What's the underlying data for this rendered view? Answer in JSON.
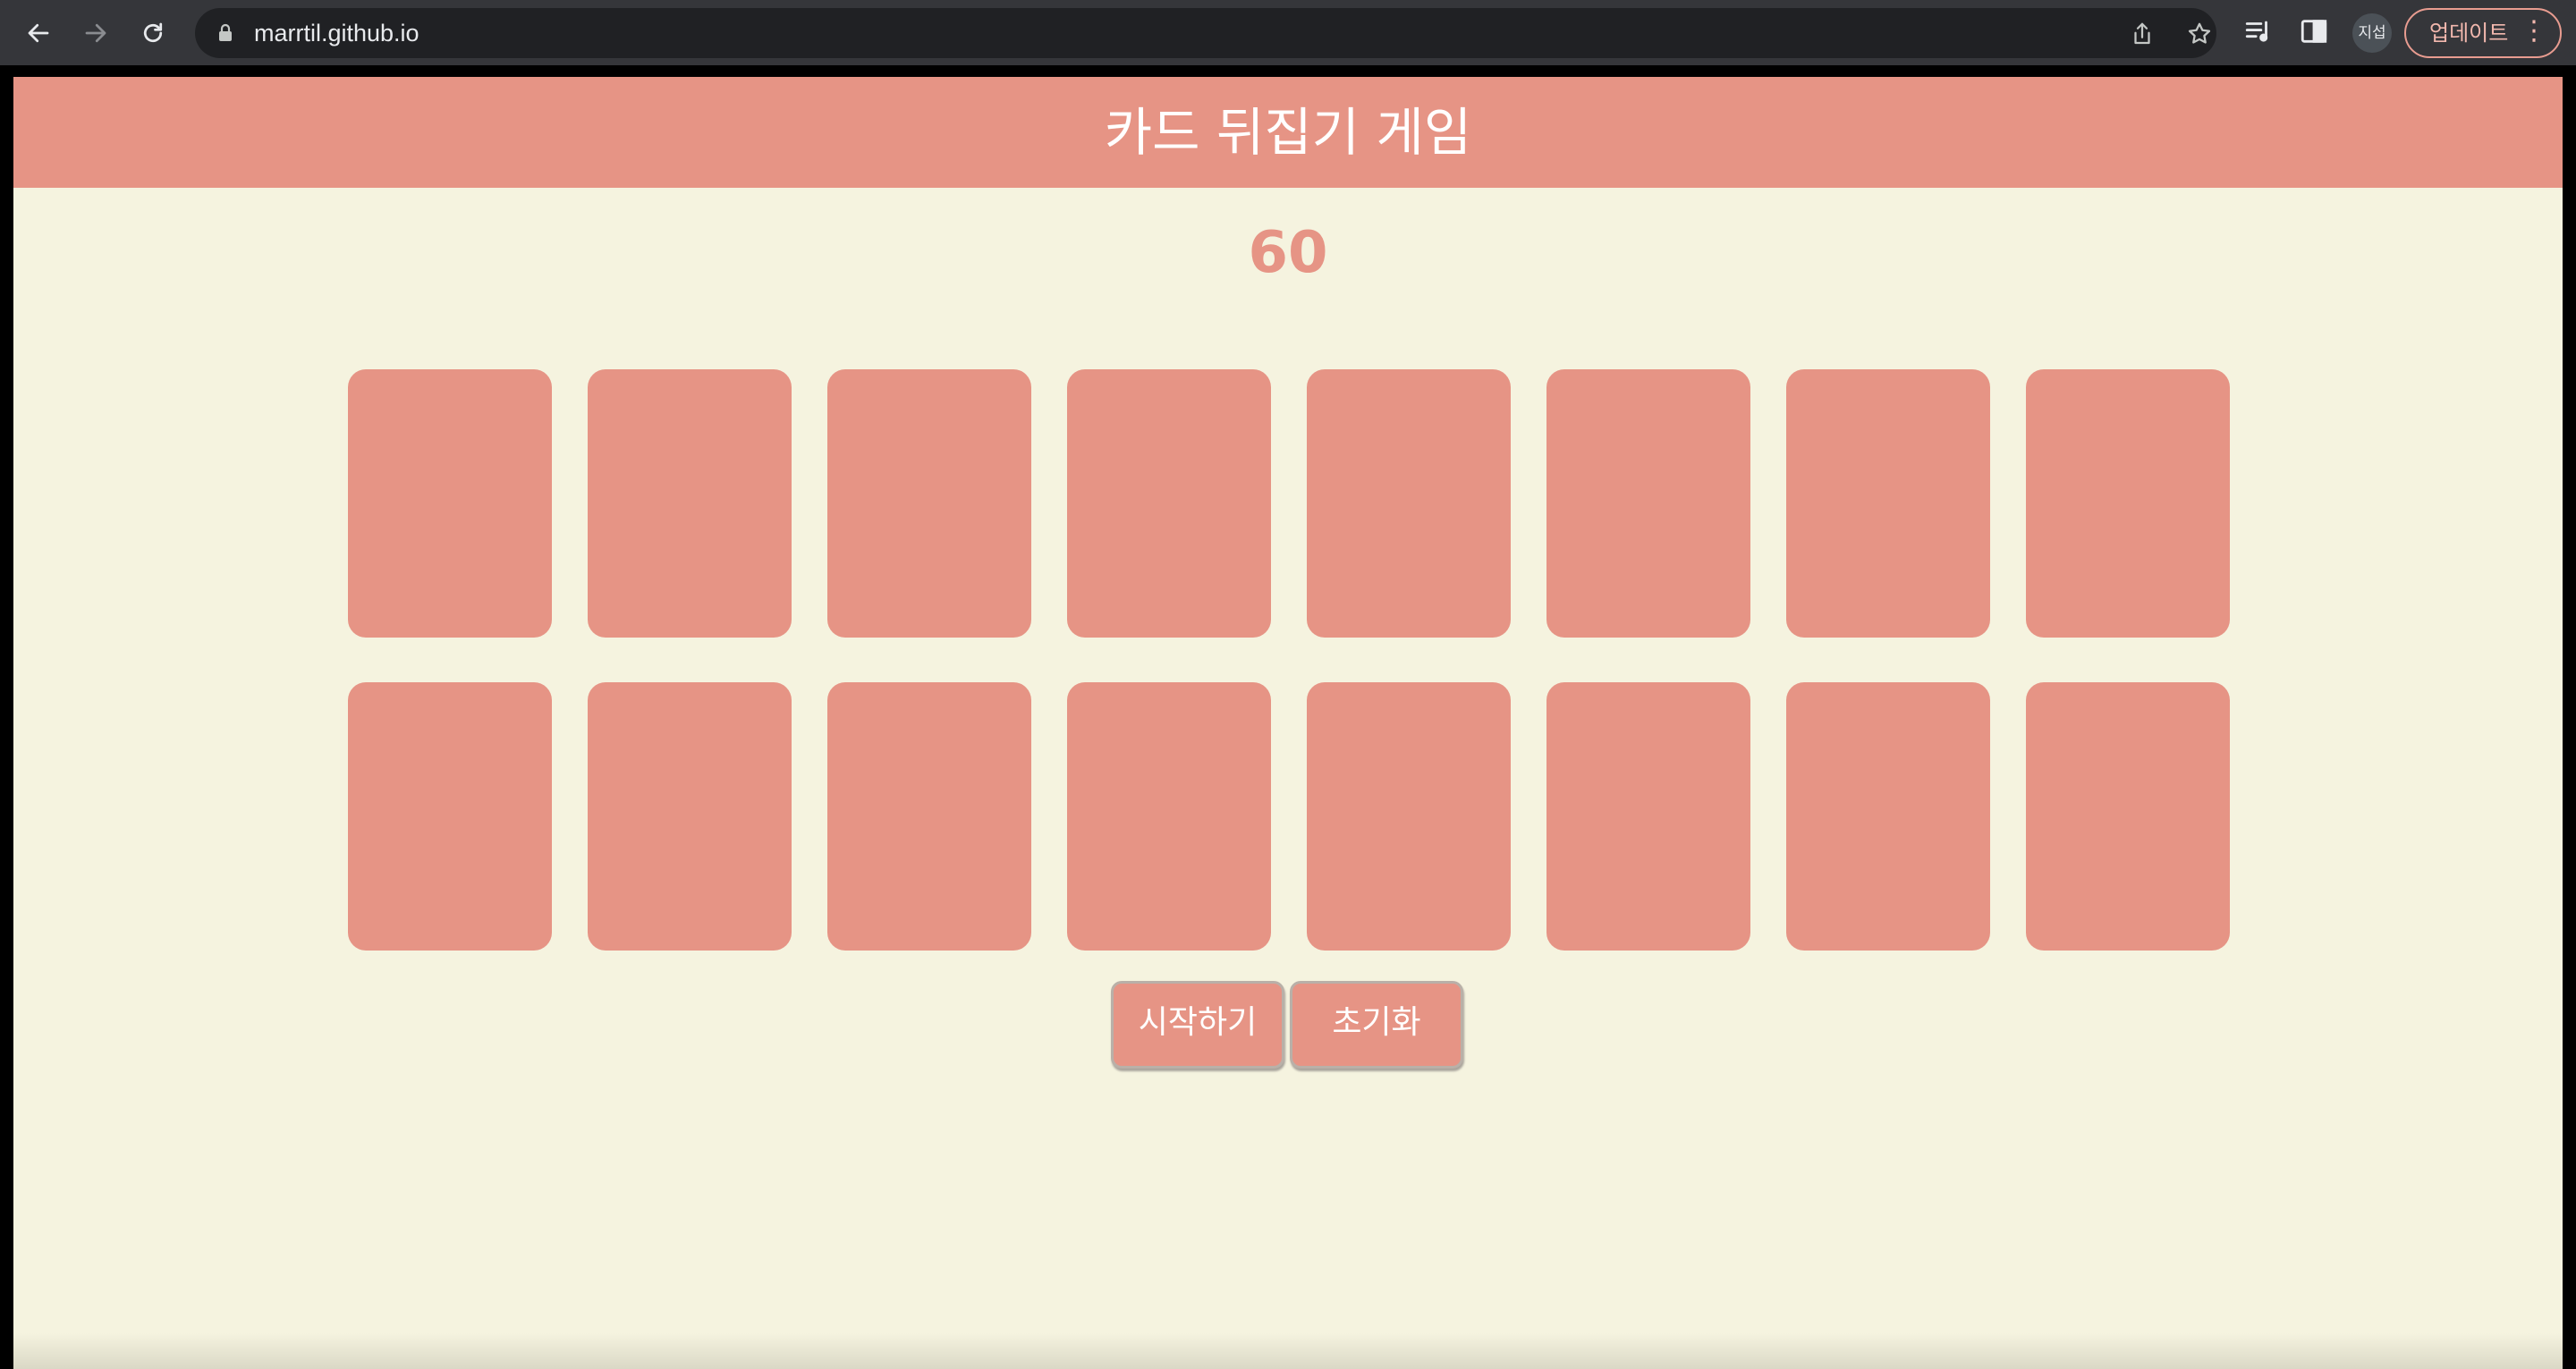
{
  "browser": {
    "url": "marrtil.github.io",
    "profile_initials": "지섭",
    "update_label": "업데이트",
    "icons": [
      "back-icon",
      "forward-icon",
      "reload-icon",
      "lock-icon",
      "share-icon",
      "star-icon",
      "reading-list-icon",
      "side-panel-icon",
      "more-vert-icon"
    ]
  },
  "page": {
    "title": "카드 뒤집기 게임",
    "timer": "60",
    "cards": [
      {
        "row": 1,
        "col": 1
      },
      {
        "row": 1,
        "col": 2
      },
      {
        "row": 1,
        "col": 3
      },
      {
        "row": 1,
        "col": 4
      },
      {
        "row": 1,
        "col": 5
      },
      {
        "row": 1,
        "col": 6
      },
      {
        "row": 1,
        "col": 7
      },
      {
        "row": 1,
        "col": 8
      },
      {
        "row": 2,
        "col": 1
      },
      {
        "row": 2,
        "col": 2
      },
      {
        "row": 2,
        "col": 3
      },
      {
        "row": 2,
        "col": 4
      },
      {
        "row": 2,
        "col": 5
      },
      {
        "row": 2,
        "col": 6
      },
      {
        "row": 2,
        "col": 7
      },
      {
        "row": 2,
        "col": 8
      }
    ],
    "start_label": "시작하기",
    "reset_label": "초기화"
  },
  "colors": {
    "accent": "#e69485",
    "background": "#f5f3df",
    "toolbar": "#35363a",
    "omnibox": "#202124"
  }
}
